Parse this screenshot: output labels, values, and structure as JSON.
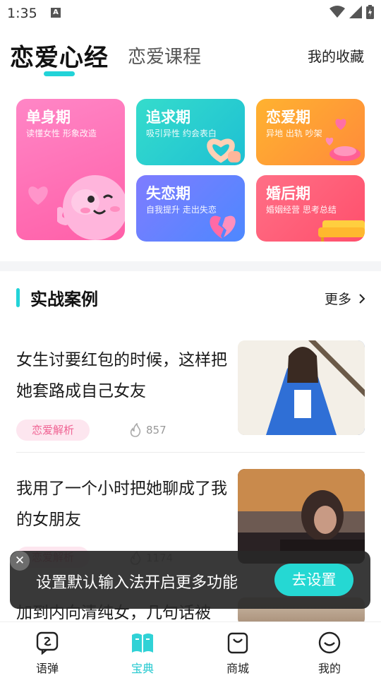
{
  "status_bar": {
    "time": "1:35"
  },
  "header": {
    "tab_active": "恋爱心经",
    "tab_other": "恋爱课程",
    "favorites": "我的收藏"
  },
  "categories": [
    {
      "title": "单身期",
      "subtitle": "读懂女性 形象改造"
    },
    {
      "title": "追求期",
      "subtitle": "吸引异性 约会表白"
    },
    {
      "title": "恋爱期",
      "subtitle": "异地 出轨 吵架"
    },
    {
      "title": "失恋期",
      "subtitle": "自我提升 走出失恋"
    },
    {
      "title": "婚后期",
      "subtitle": "婚姻经营 思考总结"
    }
  ],
  "section": {
    "title": "实战案例",
    "more": "更多"
  },
  "articles": [
    {
      "headline": "女生讨要红包的时候，这样把她套路成自己女友",
      "tag": "恋爱解析",
      "views": "857"
    },
    {
      "headline": "我用了一个小时把她聊成了我的女朋友",
      "tag": "恋爱解析",
      "views": "1174"
    },
    {
      "headline": "加到内向清纯女，几句话被"
    }
  ],
  "toast": {
    "message": "设置默认输入法开启更多功能",
    "button": "去设置"
  },
  "bottom_nav": [
    {
      "label": "语弹",
      "icon": "chat-icon"
    },
    {
      "label": "宝典",
      "icon": "book-icon",
      "active": true
    },
    {
      "label": "商城",
      "icon": "shop-bag-icon"
    },
    {
      "label": "我的",
      "icon": "smile-icon"
    }
  ],
  "colors": {
    "accent": "#22d3d8",
    "tag_bg": "#fde6ef",
    "tag_text": "#f06292"
  }
}
